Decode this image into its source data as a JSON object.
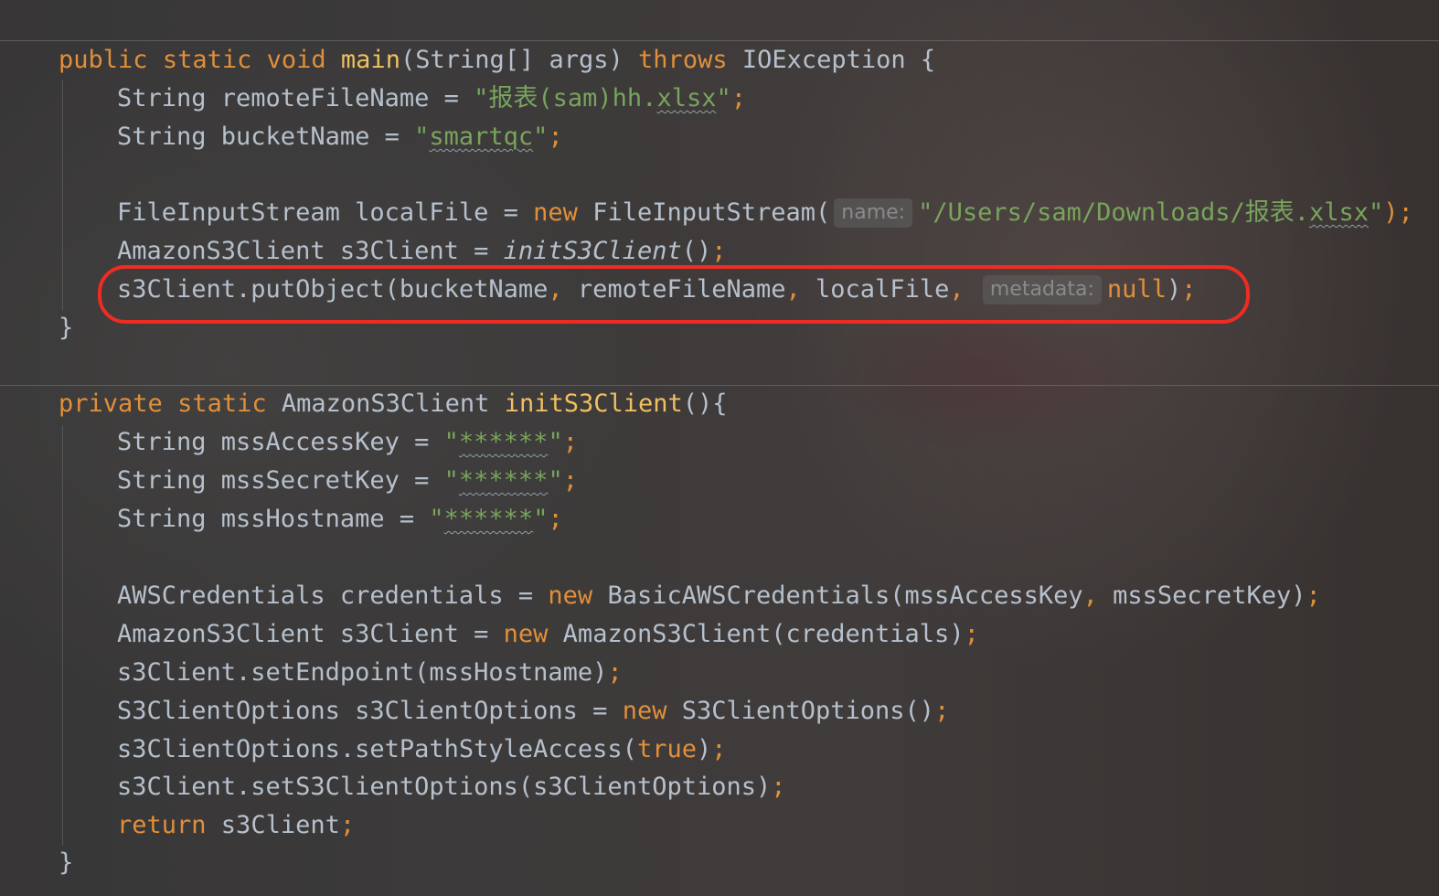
{
  "code": {
    "main_method": {
      "signature": {
        "mod1": "public",
        "mod2": "static",
        "ret": "void",
        "name": "main",
        "params": "(String[] args) ",
        "throws_kw": "throws",
        "exception": " IOException {"
      },
      "line_remote": {
        "decl": "String remoteFileName = ",
        "str_a": "\"报表(sam)hh.",
        "str_b": "xlsx",
        "str_c": "\"",
        "end": ";"
      },
      "line_bucket": {
        "decl": "String bucketName = ",
        "str_a": "\"",
        "str_b": "smartqc",
        "str_c": "\"",
        "end": ";"
      },
      "line_localfile": {
        "decl": "FileInputStream localFile = ",
        "new_kw": "new",
        "ctor": " FileInputStream(",
        "hint": "name:",
        "str_a": "\"/Users/sam/Downloads/报表.",
        "str_b": "xlsx",
        "str_c": "\"",
        "end": ");"
      },
      "line_client": {
        "decl": "AmazonS3Client s3Client = ",
        "call": "initS3Client",
        "end_a": "()",
        "end_b": ";"
      },
      "line_put": {
        "call": "s3Client.putObject(bucketName",
        "c1": ",",
        "arg2": " remoteFileName",
        "c2": ",",
        "arg3": " localFile",
        "c3": ",",
        "hint": "metadata:",
        "null_kw": "null",
        "end_a": ")",
        "end_b": ";"
      },
      "close": "}"
    },
    "init_method": {
      "signature": {
        "mod1": "private",
        "mod2": "static",
        "ret": " AmazonS3Client ",
        "name": "initS3Client",
        "rest": "(){"
      },
      "line_access": {
        "decl": "String mssAccessKey = ",
        "q1": "\"",
        "value": "******",
        "q2": "\"",
        "end": ";"
      },
      "line_secret": {
        "decl": "String mssSecretKey = ",
        "q1": "\"",
        "value": "******",
        "q2": "\"",
        "end": ";"
      },
      "line_host": {
        "decl": "String mssHostname = ",
        "q1": "\"",
        "value": "******",
        "q2": "\"",
        "end": ";"
      },
      "line_creds": {
        "decl": "AWSCredentials credentials = ",
        "new_kw": "new",
        "ctor": " BasicAWSCredentials(mssAccessKey",
        "comma": ",",
        "arg2": " mssSecretKey)",
        "end": ";"
      },
      "line_newclient": {
        "decl": "AmazonS3Client s3Client = ",
        "new_kw": "new",
        "ctor": " AmazonS3Client(credentials)",
        "end": ";"
      },
      "line_endpoint": {
        "call": "s3Client.setEndpoint(mssHostname)",
        "end": ";"
      },
      "line_options": {
        "decl": "S3ClientOptions s3ClientOptions = ",
        "new_kw": "new",
        "ctor": " S3ClientOptions()",
        "end": ";"
      },
      "line_pathstyle": {
        "call": "s3ClientOptions.setPathStyleAccess(",
        "true_kw": "true",
        "close": ")",
        "end": ";"
      },
      "line_setopts": {
        "call": "s3Client.setS3ClientOptions(s3ClientOptions)",
        "end": ";"
      },
      "line_return": {
        "return_kw": "return",
        "value": " s3Client",
        "end": ";"
      },
      "close": "}"
    }
  },
  "colors": {
    "keyword": "#e08f3a",
    "method_name": "#f0c060",
    "string": "#78a45c",
    "identifier": "#b6c0cc",
    "highlight": "#ee2c22"
  }
}
